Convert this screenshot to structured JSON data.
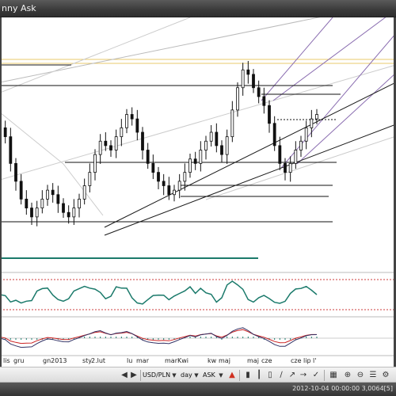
{
  "window": {
    "title": "nny Ask"
  },
  "colors": {
    "candle": "#111111",
    "trendline_dark": "#1a1a1a",
    "trendline_light": "#bbbbbb",
    "channel_purple": "#8a6db0",
    "resistance_yellow": "#e8c96b",
    "rsi_line": "#1b7a6b",
    "rsi_level": "#cc3b3b",
    "macd_red": "#cc2222",
    "macd_dark": "#333366",
    "histogram": "#1b7a6b",
    "volume_line": "#1b7a6b"
  },
  "x_axis": {
    "labels": [
      "lis",
      "gru",
      "gn2013",
      "sty",
      "2.lut",
      "lu",
      "mar",
      "marKwi",
      "kw",
      "maj",
      "maj",
      "cze",
      "cze",
      "lip",
      "l'"
    ]
  },
  "toolbar": {
    "symbol": "USD/PLN",
    "period": "day",
    "price_type": "ASK",
    "icons": [
      "prev-icon",
      "next-icon",
      "symbol-dropdown-icon",
      "period-dropdown-icon",
      "price-dropdown-icon",
      "fire-icon",
      "chart-type-icon",
      "bar-icon",
      "candle-icon",
      "line-icon",
      "trend-icon",
      "arrow-icon",
      "cursor-icon",
      "zoom-in-icon",
      "zoom-out-icon",
      "grid-icon",
      "more-icon"
    ]
  },
  "status": {
    "text": "2012-10-04 00:00:00  3,0064[5]"
  },
  "chart_data": {
    "type": "candlestick",
    "series": [
      {
        "name": "",
        "values": [
          3.3,
          3.28,
          3.22,
          3.18,
          3.14,
          3.12,
          3.1,
          3.12,
          3.14,
          3.16,
          3.15,
          3.13,
          3.11,
          3.1,
          3.12,
          3.14,
          3.17,
          3.2,
          3.24,
          3.27,
          3.26,
          3.25,
          3.28,
          3.3,
          3.33,
          3.32,
          3.29,
          3.25,
          3.22,
          3.2,
          3.18,
          3.17,
          3.15,
          3.16,
          3.18,
          3.2,
          3.23,
          3.22,
          3.25,
          3.27,
          3.29,
          3.26,
          3.24,
          3.28,
          3.34,
          3.39,
          3.43,
          3.42,
          3.39,
          3.37,
          3.35,
          3.31,
          3.26,
          3.22,
          3.2,
          3.22,
          3.25,
          3.27,
          3.3,
          3.32,
          3.33
        ]
      }
    ],
    "indicators": [
      "RSI",
      "MACD"
    ],
    "grid": false,
    "legend": "none"
  }
}
